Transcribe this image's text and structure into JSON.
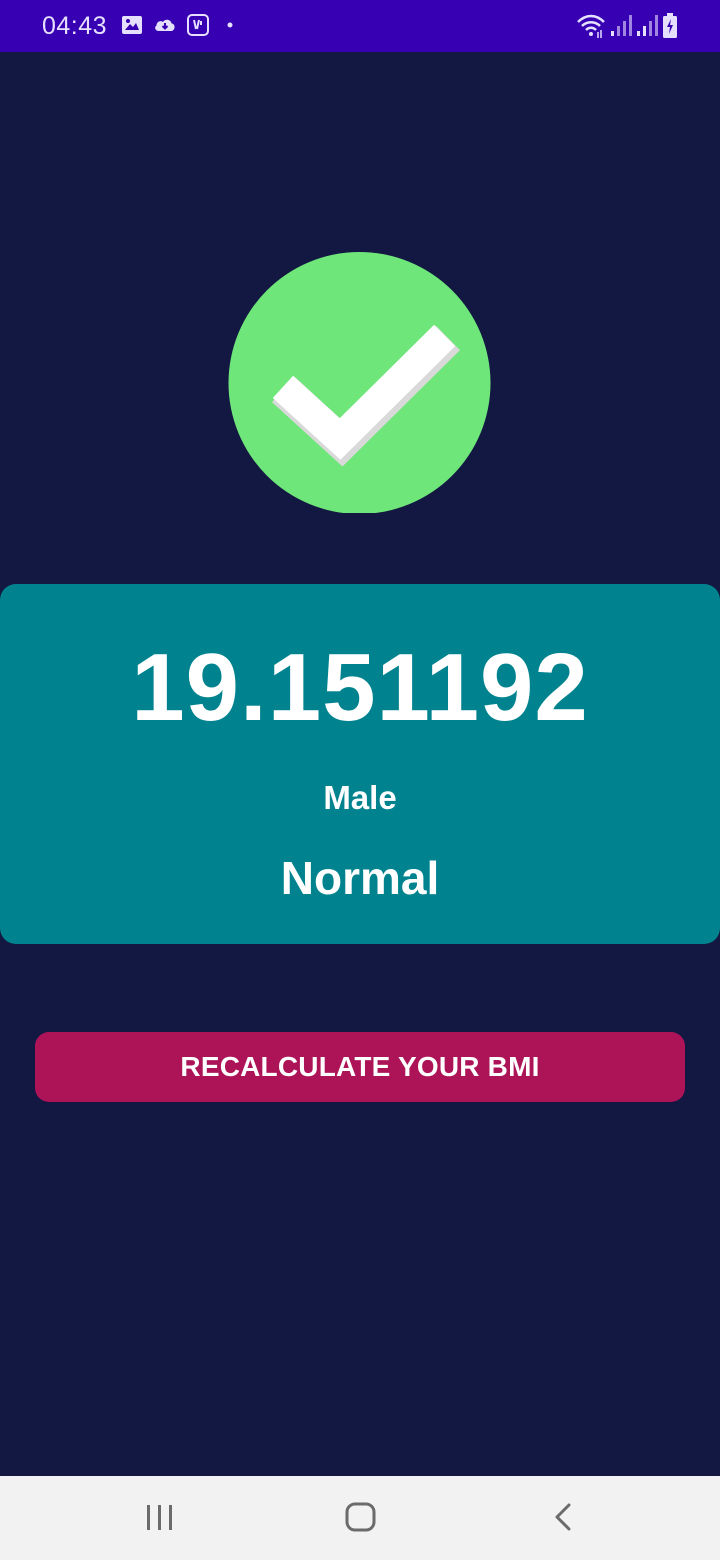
{
  "status_bar": {
    "time": "04:43",
    "left_icons": [
      "image-icon",
      "cloud-download-icon",
      "voicemail-icon",
      "dot-icon"
    ],
    "right_icons": [
      "wifi-icon",
      "signal-icon",
      "signal-icon",
      "battery-charging-icon"
    ],
    "background": "#3700b3"
  },
  "result": {
    "status_icon": "check-circle-icon",
    "bmi_value": "19.151192",
    "gender": "Male",
    "category": "Normal"
  },
  "actions": {
    "recalculate_label": "RECALCULATE YOUR BMI"
  },
  "nav_bar": {
    "buttons": [
      "recent-apps-icon",
      "home-icon",
      "back-icon"
    ]
  },
  "colors": {
    "background": "#131842",
    "card": "#00838f",
    "button": "#ad1457",
    "check": "#6ee67a"
  }
}
